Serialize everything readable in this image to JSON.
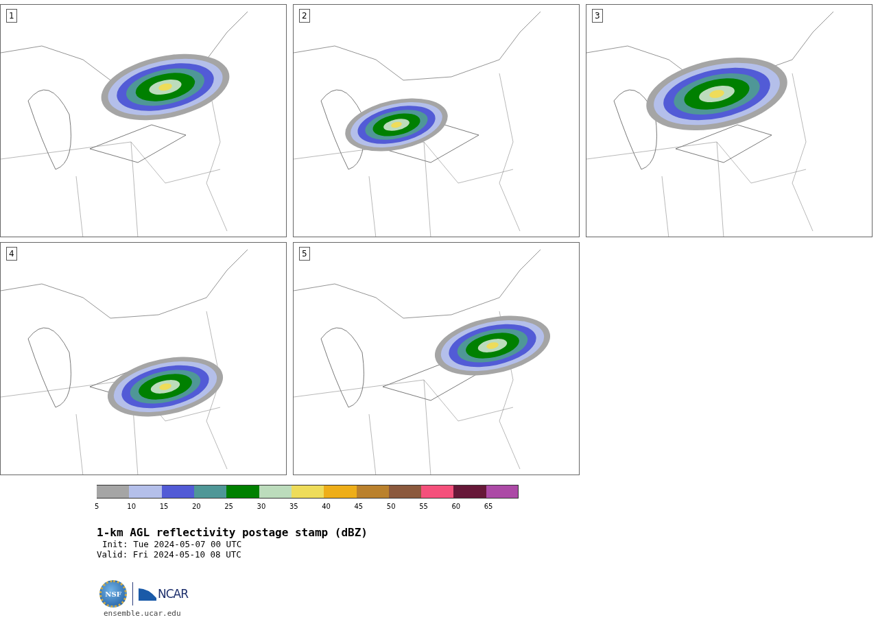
{
  "panels": [
    {
      "label": "1"
    },
    {
      "label": "2"
    },
    {
      "label": "3"
    },
    {
      "label": "4"
    },
    {
      "label": "5"
    }
  ],
  "colorbar": {
    "segments": [
      {
        "color": "#a5a5a5"
      },
      {
        "color": "#b4bfea"
      },
      {
        "color": "#525bd6"
      },
      {
        "color": "#4f9797"
      },
      {
        "color": "#008000"
      },
      {
        "color": "#bcdcbc"
      },
      {
        "color": "#eedc5a"
      },
      {
        "color": "#eeae19"
      },
      {
        "color": "#ba812d"
      },
      {
        "color": "#8b593d"
      },
      {
        "color": "#f4507b"
      },
      {
        "color": "#661838"
      },
      {
        "color": "#ac4aa6"
      }
    ],
    "ticks": [
      "5",
      "10",
      "15",
      "20",
      "25",
      "30",
      "35",
      "40",
      "45",
      "50",
      "55",
      "60",
      "65"
    ]
  },
  "title": "1-km AGL reflectivity postage stamp (dBZ)",
  "init": "Init: Tue 2024-05-07 00 UTC",
  "valid": "Valid: Fri 2024-05-10 08 UTC",
  "logos": {
    "nsf": "NSF",
    "ncar": "NCAR"
  },
  "url": "ensemble.ucar.edu"
}
